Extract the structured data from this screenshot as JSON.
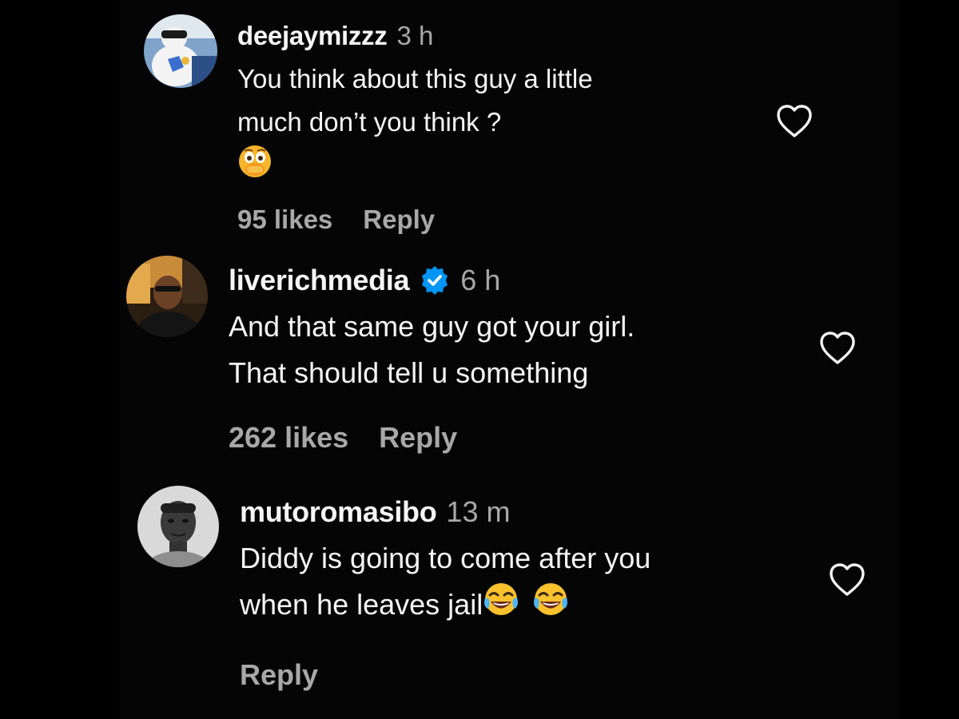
{
  "colors": {
    "background": "#000000",
    "text": "#f5f5f5",
    "muted": "#a8a8a8",
    "verified": "#0095f6"
  },
  "comments": [
    {
      "username": "deejaymizzz",
      "time": "3 h",
      "verified": false,
      "text_lines": [
        "You think about this guy a little",
        "much don’t you think ?"
      ],
      "emoji": "flushed-face-hand-over-mouth",
      "likes": "95 likes",
      "reply_label": "Reply",
      "avatar_icon": "avatar-photo"
    },
    {
      "username": "liverichmedia",
      "time": "6 h",
      "verified": true,
      "verified_icon": "verified-badge-icon",
      "text_lines": [
        "And that same guy got your girl.",
        "That should tell u something"
      ],
      "likes": "262 likes",
      "reply_label": "Reply",
      "avatar_icon": "avatar-photo"
    },
    {
      "username": "mutoromasibo",
      "time": "13 m",
      "verified": false,
      "text_lines": [
        "Diddy is going to come after you",
        "when he leaves jail"
      ],
      "emoji": "face-with-tears-of-joy",
      "likes": "",
      "reply_label": "Reply",
      "avatar_icon": "avatar-photo"
    }
  ]
}
